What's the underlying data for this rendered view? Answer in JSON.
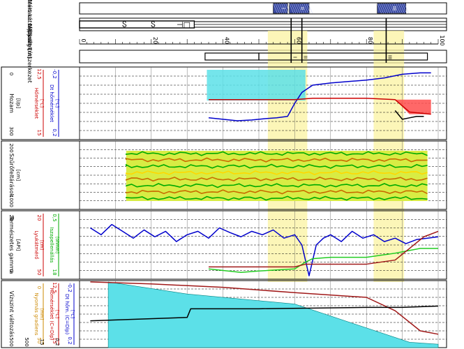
{
  "chart_data": {
    "type": "line",
    "orientation": "rotated-90",
    "depth_axis": {
      "label": "Mélység [m]",
      "range": [
        0,
        100
      ],
      "ticks": [
        "0",
        "20",
        "40",
        "60",
        "80",
        "100"
      ]
    },
    "highlight_zones": [
      {
        "from": 52.5,
        "to": 63.5
      },
      {
        "from": 82,
        "to": 90.5
      }
    ],
    "zone_markers": {
      "I": 59,
      "II": 62,
      "III": 85.5
    },
    "tracks": [
      {
        "id": "aktiv",
        "label": "Aktív szakasz. tájp",
        "hatched_blocks": [
          {
            "from": 54,
            "to": 58,
            "label": "I"
          },
          {
            "from": 58.5,
            "to": 64,
            "label": "II"
          },
          {
            "from": 83,
            "to": 91,
            "label": "III"
          }
        ]
      },
      {
        "id": "mert",
        "label": "Mért kútszerkezet",
        "symbols": [
          {
            "depth": 12.5,
            "glyph": "Ⴝ"
          },
          {
            "depth": 20.5,
            "glyph": "Ⴝ"
          },
          {
            "depth": 29,
            "glyph": "⊣□"
          }
        ]
      },
      {
        "id": "kozolt",
        "label": "Közölt kútszerkezet",
        "segments": [
          {
            "from": 35,
            "to": 50
          },
          {
            "from": 50,
            "to": 97
          }
        ]
      },
      {
        "id": "hozam",
        "label": "Hozam",
        "unit": "[l/p]",
        "scale": {
          "min": "0",
          "max": "300"
        },
        "extra_scales": [
          {
            "label": "Hőmérséklet",
            "unit": "[°C]",
            "min": "12,5",
            "max": "15",
            "color": "#cc0000"
          },
          {
            "label": "Dt hőmérséklet",
            "unit": "[°C]",
            "min": "-0,2",
            "max": "0,2",
            "color": "#0000cc"
          }
        ],
        "flow_fill": [
          [
            35.5,
            0
          ],
          [
            63,
            0
          ],
          [
            63,
            100
          ],
          [
            35.5,
            100
          ]
        ],
        "series": [
          {
            "color": "#0000cc",
            "points": [
              [
                36,
                70
              ],
              [
                40,
                72
              ],
              [
                44,
                74
              ],
              [
                48,
                73
              ],
              [
                52,
                71
              ],
              [
                55,
                70
              ],
              [
                58,
                68
              ],
              [
                60,
                50
              ],
              [
                62,
                35
              ],
              [
                65,
                25
              ],
              [
                70,
                22
              ],
              [
                75,
                20
              ],
              [
                80,
                18
              ],
              [
                85,
                15
              ],
              [
                90,
                10
              ],
              [
                95,
                8
              ],
              [
                98,
                8
              ]
            ]
          },
          {
            "color": "#cc0000",
            "points": [
              [
                36,
                45
              ],
              [
                50,
                45
              ],
              [
                60,
                45
              ],
              [
                65,
                43
              ],
              [
                70,
                43
              ],
              [
                80,
                43
              ],
              [
                88,
                45
              ],
              [
                92,
                62
              ],
              [
                98,
                65
              ]
            ]
          },
          {
            "color": "#000000",
            "points": [
              [
                88,
                60
              ],
              [
                90,
                72
              ],
              [
                92,
                70
              ],
              [
                94,
                68
              ],
              [
                96,
                68
              ]
            ]
          }
        ],
        "red_fill": [
          [
            88,
            45
          ],
          [
            98,
            45
          ],
          [
            98,
            65
          ],
          [
            92,
            65
          ]
        ]
      },
      {
        "id": "szuro",
        "label": "Szűrőfeltárások",
        "unit": "[cm]",
        "scale": {
          "min": "200",
          "max": "1000"
        },
        "band_range": [
          13,
          97
        ],
        "band_color": "#d8ec44",
        "line_colors": [
          "#00aa00",
          "#c86b00",
          "#00aa00",
          "#ffd800",
          "#c86b00",
          "#00aa00",
          "#c86b00",
          "#00aa00"
        ]
      },
      {
        "id": "gamma",
        "label": "Természetes gamma",
        "unit": "[API]",
        "scale": {
          "min": "20",
          "max": "0"
        },
        "extra_scales": [
          {
            "label": "Lyukátmérő",
            "unit": "[cm]",
            "min": "20",
            "max": "50",
            "color": "#cc0000"
          },
          {
            "label": "Iszapellenállás",
            "unit": "[ohmm]",
            "min": "0,5",
            "max": "18",
            "color": "#00aa00"
          }
        ],
        "series": [
          {
            "color": "#0000cc",
            "points": [
              [
                3,
                25
              ],
              [
                6,
                35
              ],
              [
                9,
                20
              ],
              [
                12,
                30
              ],
              [
                15,
                40
              ],
              [
                18,
                28
              ],
              [
                21,
                38
              ],
              [
                24,
                30
              ],
              [
                27,
                45
              ],
              [
                30,
                35
              ],
              [
                33,
                30
              ],
              [
                36,
                40
              ],
              [
                39,
                25
              ],
              [
                42,
                32
              ],
              [
                45,
                38
              ],
              [
                48,
                30
              ],
              [
                51,
                35
              ],
              [
                54,
                28
              ],
              [
                57,
                40
              ],
              [
                60,
                35
              ],
              [
                62,
                50
              ],
              [
                64,
                95
              ],
              [
                66,
                50
              ],
              [
                68,
                40
              ],
              [
                70,
                35
              ],
              [
                73,
                45
              ],
              [
                76,
                30
              ],
              [
                79,
                40
              ],
              [
                82,
                35
              ],
              [
                85,
                45
              ],
              [
                88,
                40
              ],
              [
                91,
                48
              ],
              [
                94,
                42
              ],
              [
                97,
                40
              ],
              [
                100,
                38
              ]
            ]
          },
          {
            "color": "#22cc22",
            "points": [
              [
                36,
                85
              ],
              [
                45,
                90
              ],
              [
                50,
                88
              ],
              [
                60,
                85
              ],
              [
                63,
                75
              ],
              [
                65,
                70
              ],
              [
                70,
                68
              ],
              [
                80,
                68
              ],
              [
                88,
                62
              ],
              [
                95,
                55
              ],
              [
                100,
                55
              ]
            ]
          },
          {
            "color": "#a01818",
            "points": [
              [
                36,
                82
              ],
              [
                60,
                82
              ],
              [
                63,
                78
              ],
              [
                80,
                78
              ],
              [
                88,
                72
              ],
              [
                92,
                55
              ],
              [
                96,
                38
              ],
              [
                100,
                30
              ]
            ]
          }
        ]
      },
      {
        "id": "viz",
        "label": "Vízszint változás",
        "extra_scales": [
          {
            "label": "Nyomás gradiens",
            "unit": "[mm]",
            "min": "0",
            "max": "50",
            "color": "#cc8800"
          },
          {
            "label": "Hőmérséklet (C=Dlp)",
            "unit": "[°C]",
            "min": "12,5",
            "max": "15",
            "color": "#cc0000"
          },
          {
            "label": "Dt hőm. (C=Dlp)",
            "unit": "[°C]",
            "min": "-0,2",
            "max": "0,2",
            "color": "#0000cc"
          }
        ],
        "bottom_labels": [
          "500",
          "500",
          "15",
          "0,2"
        ],
        "cyan_fill": [
          [
            8,
            2
          ],
          [
            30,
            20
          ],
          [
            60,
            35
          ],
          [
            92,
            92
          ],
          [
            100,
            95
          ],
          [
            100,
            100
          ],
          [
            8,
            100
          ]
        ],
        "series": [
          {
            "color": "#a01818",
            "points": [
              [
                3,
                2
              ],
              [
                20,
                5
              ],
              [
                40,
                10
              ],
              [
                60,
                18
              ],
              [
                80,
                25
              ],
              [
                88,
                45
              ],
              [
                95,
                75
              ],
              [
                100,
                80
              ]
            ]
          },
          {
            "color": "#000000",
            "points": [
              [
                3,
                60
              ],
              [
                30,
                55
              ],
              [
                31,
                42
              ],
              [
                50,
                42
              ],
              [
                80,
                40
              ],
              [
                90,
                40
              ],
              [
                100,
                38
              ]
            ]
          }
        ]
      }
    ],
    "grid": true
  }
}
